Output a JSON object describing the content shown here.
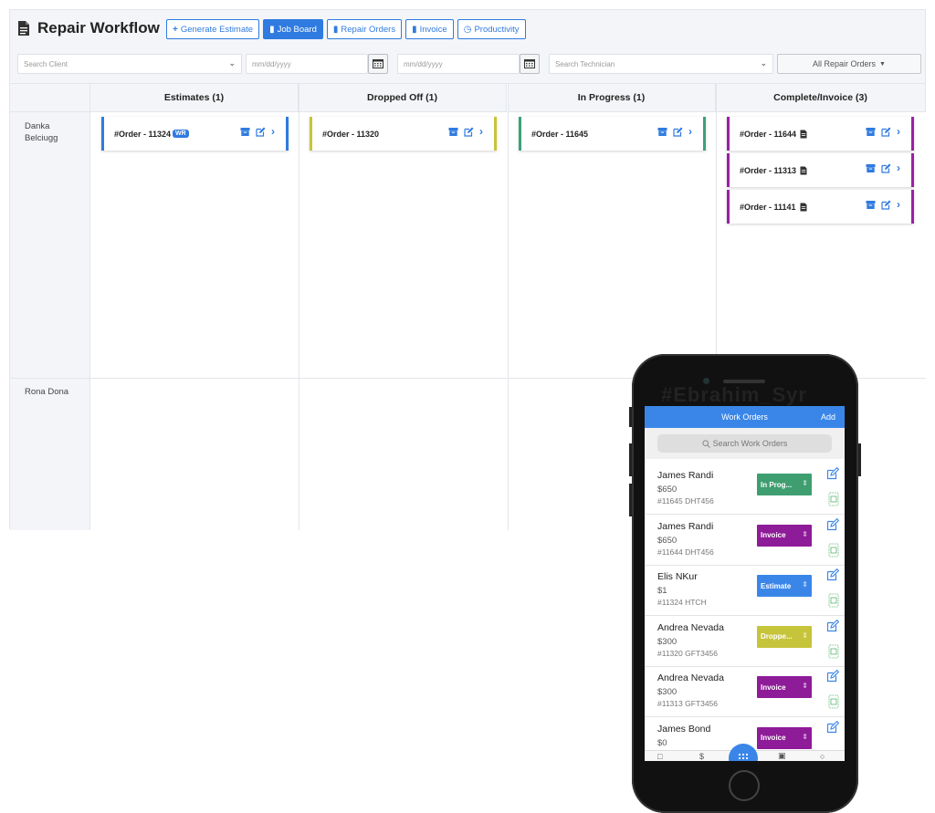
{
  "header": {
    "title": "Repair Workflow",
    "buttons": [
      {
        "icon": "+",
        "label": "Generate Estimate",
        "active": false
      },
      {
        "icon": "doc",
        "label": "Job Board",
        "active": true
      },
      {
        "icon": "doc",
        "label": "Repair Orders",
        "active": false
      },
      {
        "icon": "doc",
        "label": "Invoice",
        "active": false
      },
      {
        "icon": "clock",
        "label": "Productivity",
        "active": false
      }
    ]
  },
  "filters": {
    "client_placeholder": "Search Client",
    "date_from_placeholder": "mm/dd/yyyy",
    "date_to_placeholder": "mm/dd/yyyy",
    "technician_placeholder": "Search Technician",
    "orders_select": "All Repair Orders"
  },
  "board": {
    "columns": [
      {
        "label": "Estimates (1)",
        "color": "#2f7be0"
      },
      {
        "label": "Dropped Off (1)",
        "color": "#c8c43a"
      },
      {
        "label": "In Progress (1)",
        "color": "#3aa27a"
      },
      {
        "label": "Complete/Invoice (3)",
        "color": "#9b1fa6"
      }
    ],
    "rows": [
      {
        "name": "Danka Belciugg"
      },
      {
        "name": "Rona Dona"
      }
    ],
    "cards": [
      {
        "col": 0,
        "slot": 0,
        "order": "#Order - 11324",
        "badge": "WR",
        "doc": false
      },
      {
        "col": 1,
        "slot": 0,
        "order": "#Order - 11320",
        "badge": "",
        "doc": false
      },
      {
        "col": 2,
        "slot": 0,
        "order": "#Order - 11645",
        "badge": "",
        "doc": false
      },
      {
        "col": 3,
        "slot": 0,
        "order": "#Order - 11644",
        "badge": "",
        "doc": true
      },
      {
        "col": 3,
        "slot": 1,
        "order": "#Order - 11313",
        "badge": "",
        "doc": true
      },
      {
        "col": 3,
        "slot": 2,
        "order": "#Order - 11141",
        "badge": "",
        "doc": true
      }
    ]
  },
  "phone": {
    "watermark": "#Ebrahim_Syr",
    "nav_title": "Work Orders",
    "nav_action": "Add",
    "search_placeholder": "Search Work Orders",
    "items": [
      {
        "name": "James Randi",
        "price": "$650",
        "id": "#11645 DHT456",
        "status": "In Prog...",
        "color": "#3f9e70"
      },
      {
        "name": "James Randi",
        "price": "$650",
        "id": "#11644 DHT456",
        "status": "Invoice",
        "color": "#8e1b98"
      },
      {
        "name": "Elis NKur",
        "price": "$1",
        "id": "#11324 HTCH",
        "status": "Estimate",
        "color": "#3a86e8"
      },
      {
        "name": "Andrea Nevada",
        "price": "$300",
        "id": "#11320 GFT3456",
        "status": "Droppe...",
        "color": "#c6c43a"
      },
      {
        "name": "Andrea Nevada",
        "price": "$300",
        "id": "#11313 GFT3456",
        "status": "Invoice",
        "color": "#8e1b98"
      },
      {
        "name": "James Bond",
        "price": "$0",
        "id": "",
        "status": "Invoice",
        "color": "#8e1b98"
      }
    ]
  }
}
